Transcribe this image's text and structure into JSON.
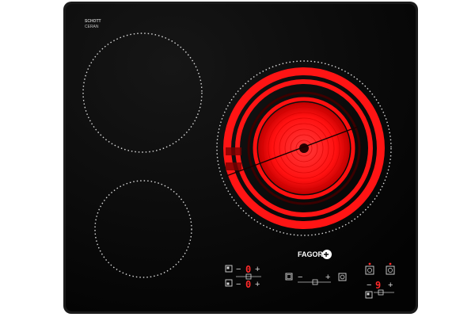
{
  "hob": {
    "glass_color": "#050505",
    "frame_color": "#1a1a1a",
    "zone_outline_color": "#d9d9d9",
    "heat_color": "#ff1414",
    "logo_top": "SCHOTT",
    "logo_bottom": "CERAN",
    "brand": "FAGOR",
    "zones": {
      "top_left": {
        "state": "off"
      },
      "bottom_left": {
        "state": "off"
      },
      "right_dual": {
        "state": "on"
      }
    }
  },
  "controls": {
    "row1": {
      "minus": "−",
      "digit": "0",
      "plus": "+"
    },
    "row2": {
      "minus": "−",
      "digit": "0",
      "plus": "+"
    },
    "center": {
      "minus": "−",
      "plus": "+"
    },
    "right": {
      "minus": "−",
      "digit": "9",
      "plus": "+"
    },
    "display_color": "#ff2a2a",
    "icon_color": "#d9d9d9"
  }
}
